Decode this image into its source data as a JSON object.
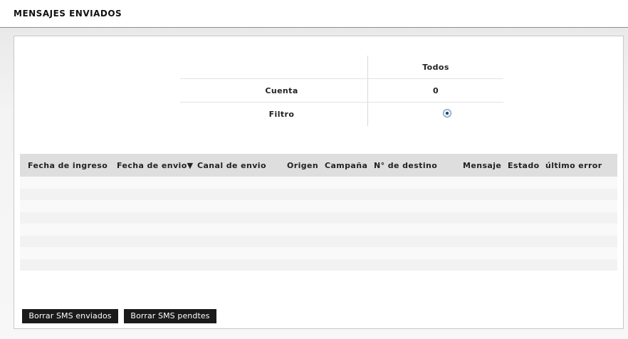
{
  "header": {
    "title": "MENSAJES ENVIADOS"
  },
  "summary": {
    "column_header": "Todos",
    "rows": [
      {
        "label": "Cuenta",
        "value": "0"
      },
      {
        "label": "Filtro",
        "value": ""
      }
    ],
    "filter_selected": true
  },
  "table": {
    "columns": [
      "Fecha de ingreso",
      "Fecha de envio▼",
      "Canal de envio",
      "Origen",
      "Campaña",
      "N° de destino",
      "Mensaje",
      "Estado",
      "último error"
    ],
    "row_count": 8,
    "rows": []
  },
  "actions": {
    "delete_sent_label": "Borrar SMS enviados",
    "delete_pending_label": "Borrar SMS pendtes"
  },
  "colors": {
    "header_bg": "#dedede",
    "button_bg": "#1a1a1a",
    "button_text": "#ffffff",
    "radio_border": "#6b8fb8"
  }
}
